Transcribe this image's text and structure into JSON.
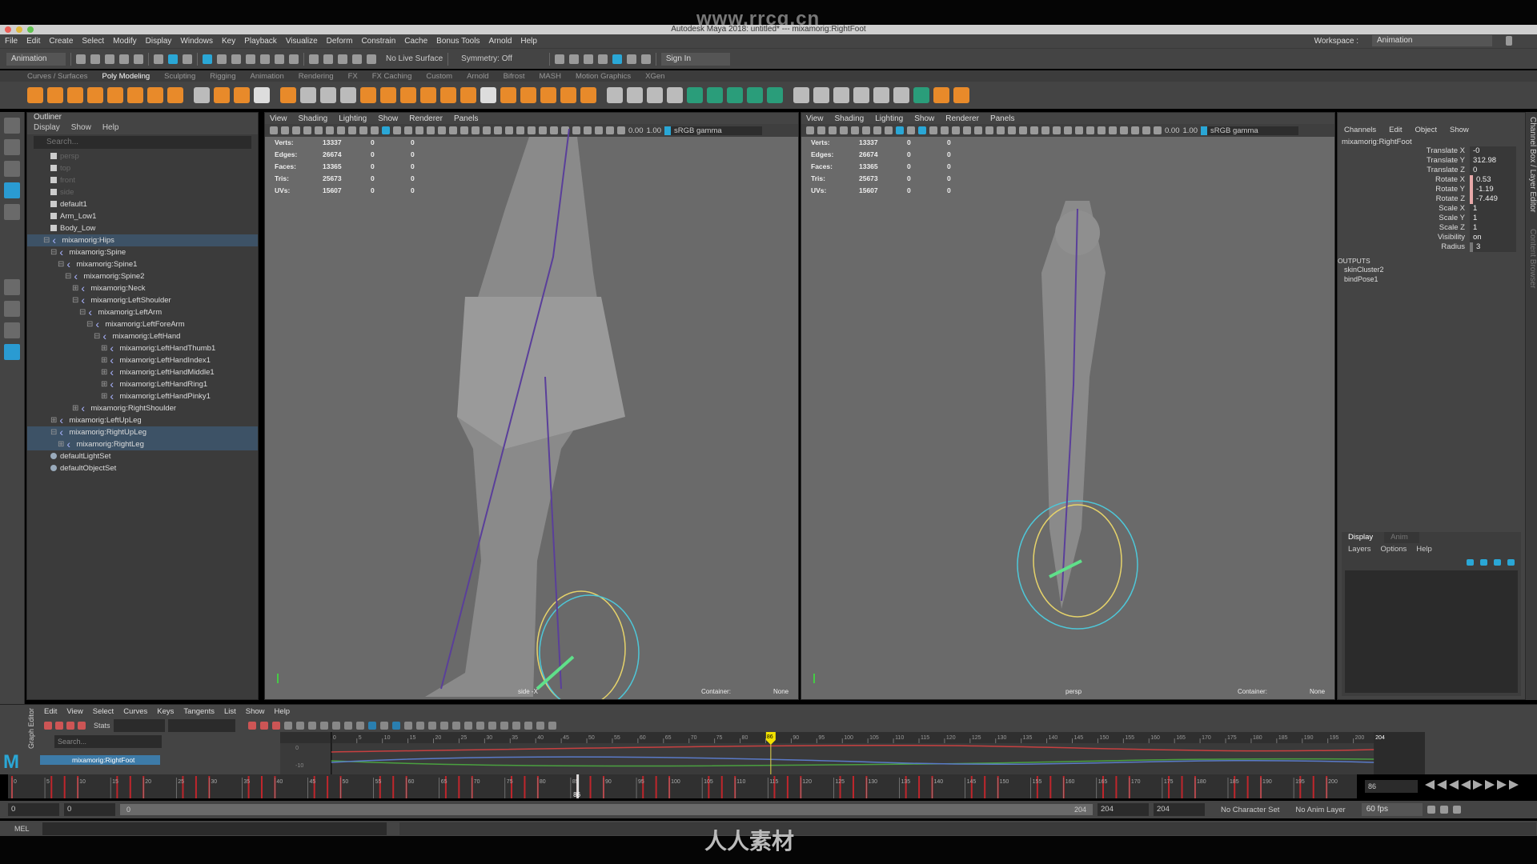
{
  "watermark_top": "www.rrcg.cn",
  "watermark_bottom": "人人素材",
  "window_title": "Autodesk Maya 2018: untitled*   ---   mixamorig:RightFoot",
  "menus": [
    "File",
    "Edit",
    "Create",
    "Select",
    "Modify",
    "Display",
    "Windows",
    "Key",
    "Playback",
    "Visualize",
    "Deform",
    "Constrain",
    "Cache",
    "Bonus Tools",
    "Arnold",
    "Help"
  ],
  "workspace": {
    "label": "Workspace :",
    "value": "Animation"
  },
  "status": {
    "mode": "Animation",
    "live_surface": "No Live Surface",
    "symmetry": "Symmetry: Off",
    "sign_in": "Sign In"
  },
  "shelf_tabs": [
    "Curves / Surfaces",
    "Poly Modeling",
    "Sculpting",
    "Rigging",
    "Animation",
    "Rendering",
    "FX",
    "FX Caching",
    "Custom",
    "Arnold",
    "Bifrost",
    "MASH",
    "Motion Graphics",
    "XGen"
  ],
  "shelf_active": "Poly Modeling",
  "outliner": {
    "title": "Outliner",
    "menus": [
      "Display",
      "Show",
      "Help"
    ],
    "search_placeholder": "Search...",
    "items": [
      {
        "label": "persp",
        "depth": 0,
        "icon": "camera",
        "dim": true
      },
      {
        "label": "top",
        "depth": 0,
        "icon": "camera",
        "dim": true
      },
      {
        "label": "front",
        "depth": 0,
        "icon": "camera",
        "dim": true
      },
      {
        "label": "side",
        "depth": 0,
        "icon": "camera",
        "dim": true
      },
      {
        "label": "default1",
        "depth": 0,
        "icon": "mesh"
      },
      {
        "label": "Arm_Low1",
        "depth": 0,
        "icon": "mesh"
      },
      {
        "label": "Body_Low",
        "depth": 0,
        "icon": "mesh"
      },
      {
        "label": "mixamorig:Hips",
        "depth": 0,
        "icon": "joint",
        "selected": true,
        "expander": "-"
      },
      {
        "label": "mixamorig:Spine",
        "depth": 1,
        "icon": "joint",
        "expander": "-"
      },
      {
        "label": "mixamorig:Spine1",
        "depth": 2,
        "icon": "joint",
        "expander": "-"
      },
      {
        "label": "mixamorig:Spine2",
        "depth": 3,
        "icon": "joint",
        "expander": "-"
      },
      {
        "label": "mixamorig:Neck",
        "depth": 4,
        "icon": "joint",
        "expander": "+"
      },
      {
        "label": "mixamorig:LeftShoulder",
        "depth": 4,
        "icon": "joint",
        "expander": "-"
      },
      {
        "label": "mixamorig:LeftArm",
        "depth": 5,
        "icon": "joint",
        "expander": "-"
      },
      {
        "label": "mixamorig:LeftForeArm",
        "depth": 6,
        "icon": "joint",
        "expander": "-"
      },
      {
        "label": "mixamorig:LeftHand",
        "depth": 7,
        "icon": "joint",
        "expander": "-"
      },
      {
        "label": "mixamorig:LeftHandThumb1",
        "depth": 8,
        "icon": "joint",
        "expander": "+"
      },
      {
        "label": "mixamorig:LeftHandIndex1",
        "depth": 8,
        "icon": "joint",
        "expander": "+"
      },
      {
        "label": "mixamorig:LeftHandMiddle1",
        "depth": 8,
        "icon": "joint",
        "expander": "+"
      },
      {
        "label": "mixamorig:LeftHandRing1",
        "depth": 8,
        "icon": "joint",
        "expander": "+"
      },
      {
        "label": "mixamorig:LeftHandPinky1",
        "depth": 8,
        "icon": "joint",
        "expander": "+"
      },
      {
        "label": "mixamorig:RightShoulder",
        "depth": 4,
        "icon": "joint",
        "expander": "+"
      },
      {
        "label": "mixamorig:LeftUpLeg",
        "depth": 1,
        "icon": "joint",
        "expander": "+"
      },
      {
        "label": "mixamorig:RightUpLeg",
        "depth": 1,
        "icon": "joint",
        "selected": true,
        "expander": "-"
      },
      {
        "label": "mixamorig:RightLeg",
        "depth": 2,
        "icon": "joint",
        "selected": true,
        "expander": "+"
      },
      {
        "label": "defaultLightSet",
        "depth": 0,
        "icon": "set"
      },
      {
        "label": "defaultObjectSet",
        "depth": 0,
        "icon": "set"
      }
    ]
  },
  "viewport_menus": [
    "View",
    "Shading",
    "Lighting",
    "Show",
    "Renderer",
    "Panels"
  ],
  "viewport_toolbar": {
    "exposure": "0.00",
    "gamma": "1.00",
    "color_space": "sRGB gamma"
  },
  "hud": [
    [
      "Verts:",
      "13337",
      "0",
      "0"
    ],
    [
      "Edges:",
      "26674",
      "0",
      "0"
    ],
    [
      "Faces:",
      "13365",
      "0",
      "0"
    ],
    [
      "Tris:",
      "25673",
      "0",
      "0"
    ],
    [
      "UVs:",
      "15607",
      "0",
      "0"
    ]
  ],
  "viewports": [
    {
      "camera": "side -X",
      "container_label": "Container:",
      "container_value": "None"
    },
    {
      "camera": "persp",
      "container_label": "Container:",
      "container_value": "None"
    }
  ],
  "channel_box": {
    "menus": [
      "Channels",
      "Edit",
      "Object",
      "Show"
    ],
    "object": "mixamorig:RightFoot",
    "channels": [
      {
        "name": "Translate X",
        "value": "-0",
        "key": ""
      },
      {
        "name": "Translate Y",
        "value": "312.98",
        "key": ""
      },
      {
        "name": "Translate Z",
        "value": "0",
        "key": ""
      },
      {
        "name": "Rotate X",
        "value": "0.53",
        "key": "k"
      },
      {
        "name": "Rotate Y",
        "value": "-1.19",
        "key": "k"
      },
      {
        "name": "Rotate Z",
        "value": "-7.449",
        "key": "k"
      },
      {
        "name": "Scale X",
        "value": "1",
        "key": ""
      },
      {
        "name": "Scale Y",
        "value": "1",
        "key": ""
      },
      {
        "name": "Scale Z",
        "value": "1",
        "key": ""
      },
      {
        "name": "Visibility",
        "value": "on",
        "key": ""
      },
      {
        "name": "Radius",
        "value": "3",
        "key": "g"
      }
    ],
    "outputs_label": "OUTPUTS",
    "outputs": [
      "skinCluster2",
      "bindPose1"
    ],
    "side_tab": "Channel Box / Layer Editor",
    "side_tab2": "Content Browser"
  },
  "layer_editor": {
    "tabs": [
      "Display",
      "Anim"
    ],
    "menus": [
      "Layers",
      "Options",
      "Help"
    ]
  },
  "graph_editor": {
    "side_label": "Graph Editor",
    "menus": [
      "Edit",
      "View",
      "Select",
      "Curves",
      "Keys",
      "Tangents",
      "List",
      "Show",
      "Help"
    ],
    "stats_label": "Stats",
    "search_placeholder": "Search...",
    "selected_node": "mixamorig:RightFoot",
    "ticks": [
      0,
      5,
      10,
      15,
      20,
      25,
      30,
      35,
      40,
      45,
      50,
      55,
      60,
      65,
      70,
      75,
      80,
      85,
      90,
      95,
      100,
      105,
      110,
      115,
      120,
      125,
      130,
      135,
      140,
      145,
      150,
      155,
      160,
      165,
      170,
      175,
      180,
      185,
      190,
      195,
      200
    ],
    "end_frame": "204",
    "current_frame": "86",
    "y_labels": [
      "0",
      "-10"
    ]
  },
  "time_slider": {
    "ticks": [
      0,
      5,
      10,
      15,
      20,
      25,
      30,
      35,
      40,
      45,
      50,
      55,
      60,
      65,
      70,
      75,
      80,
      85,
      90,
      95,
      100,
      105,
      110,
      115,
      120,
      125,
      130,
      135,
      140,
      145,
      150,
      155,
      160,
      165,
      170,
      175,
      180,
      185,
      190,
      195,
      200
    ],
    "current": "86",
    "range_end": 204
  },
  "range": {
    "start": "0",
    "anim_start": "0",
    "slider_start": "0",
    "slider_end": "204",
    "end": "204",
    "anim_end": "204",
    "character_set": "No Character Set",
    "anim_layer": "No Anim Layer",
    "fps": "60 fps"
  },
  "command_line": {
    "label": "MEL"
  },
  "colors": {
    "accent": "#2aa7d6",
    "selection": "#3d5266",
    "keyframe": "#c0262c",
    "current_frame": "#f2e200"
  }
}
